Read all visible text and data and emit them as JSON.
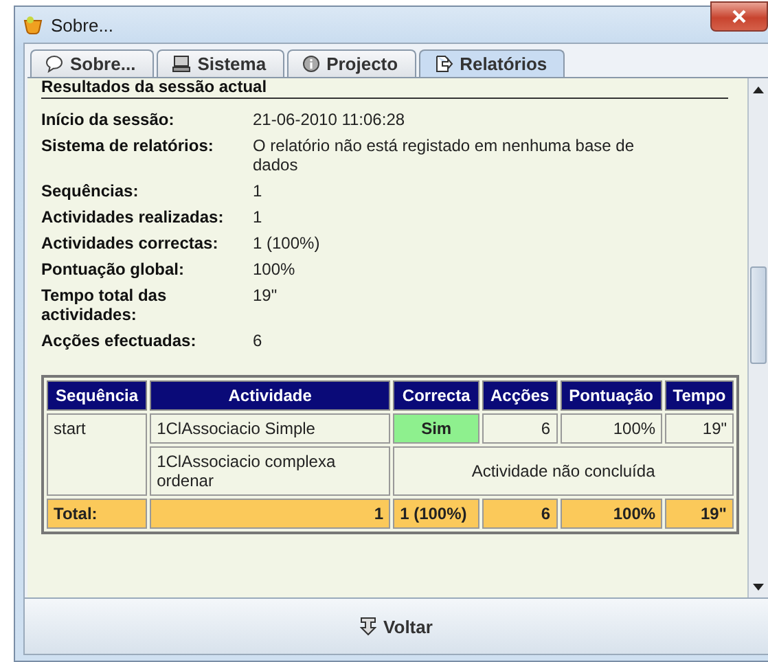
{
  "window": {
    "title": "Sobre..."
  },
  "tabs": [
    {
      "label": "Sobre...",
      "kind": "speech",
      "selected": false
    },
    {
      "label": "Sistema",
      "kind": "computer",
      "selected": false
    },
    {
      "label": "Projecto",
      "kind": "info",
      "selected": false
    },
    {
      "label": "Relatórios",
      "kind": "report",
      "selected": true
    }
  ],
  "section_title": "Resultados da sessão actual",
  "summary": [
    {
      "label": "Início da sessão:",
      "value": "21-06-2010 11:06:28"
    },
    {
      "label": "Sistema de relatórios:",
      "value": "O relatório não está registado em nenhuma base de dados"
    },
    {
      "label": "Sequências:",
      "value": "1"
    },
    {
      "label": "Actividades realizadas:",
      "value": "1"
    },
    {
      "label": "Actividades correctas:",
      "value": "1 (100%)"
    },
    {
      "label": "Pontuação global:",
      "value": "100%"
    },
    {
      "label": "Tempo total das actividades:",
      "value": "19\""
    },
    {
      "label": "Acções efectuadas:",
      "value": "6"
    }
  ],
  "table": {
    "columns": [
      "Sequência",
      "Actividade",
      "Correcta",
      "Acções",
      "Pontuação",
      "Tempo"
    ],
    "rows": [
      {
        "sequence": "start",
        "activities": [
          {
            "kind": "completed",
            "activity": "1ClAssociacio Simple",
            "correct": "Sim",
            "actions": "6",
            "score": "100%",
            "time": "19\""
          },
          {
            "kind": "incomplete",
            "activity": "1ClAssociacio complexa ordenar",
            "note": "Actividade não concluída"
          }
        ]
      }
    ],
    "total": {
      "label": "Total:",
      "activities": "1",
      "correct": "1 (100%)",
      "actions": "6",
      "score": "100%",
      "time": "19\""
    }
  },
  "footer_button": {
    "label": "Voltar"
  }
}
